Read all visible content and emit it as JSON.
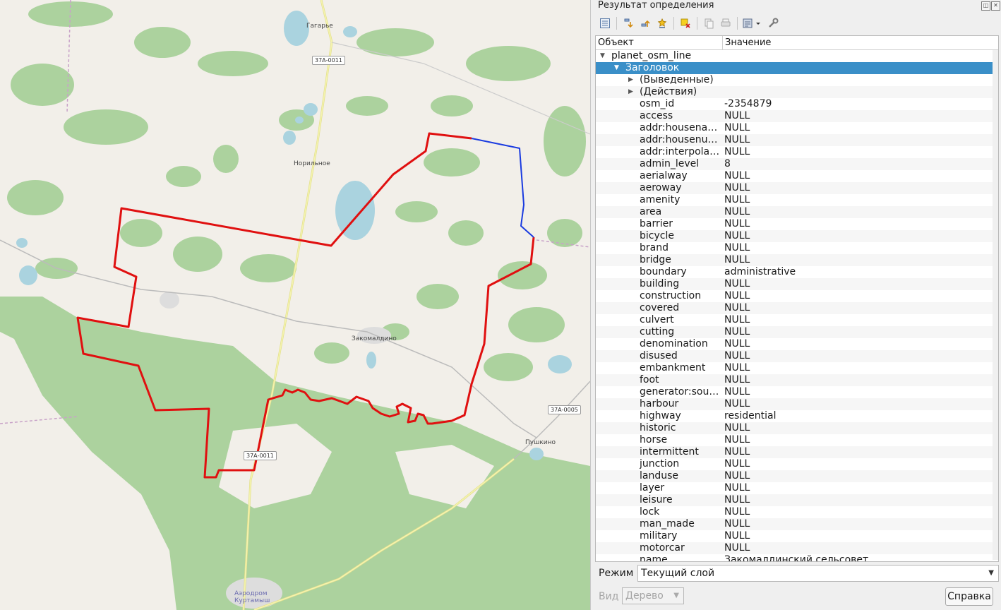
{
  "map": {
    "places": {
      "gagarye": "Гагарье",
      "norilnoe": "Норильное",
      "zakomaldino": "Закомалдино",
      "pushkino": "Пушкино",
      "airport": "Аэродром\nКуртамыш"
    },
    "road_shields": {
      "north": "37А-0011",
      "south": "37А-0011",
      "east": "37А-0005"
    },
    "colors": {
      "background": "#f2efe9",
      "forest": "#acd29e",
      "water": "#aad3df",
      "boundary_selected": "#e01010",
      "boundary_highlight": "#1a3be0",
      "road": "#f0ef9c"
    }
  },
  "panel": {
    "title": "Результат определения",
    "toolbar": {
      "icons": [
        "expand-all-icon",
        "collapse-all-icon",
        "expand-new-icon",
        "collapse-new-icon",
        "clear-selection-icon",
        "copy-attribute-icon",
        "print-icon",
        "identify-options-icon",
        "settings-icon"
      ]
    },
    "tree": {
      "col_object": "Объект",
      "col_value": "Значение",
      "layer": "planet_osm_line",
      "feature": "Заголовок",
      "derived": "(Выведенные)",
      "actions": "(Действия)",
      "attributes": [
        {
          "name": "osm_id",
          "value": "-2354879"
        },
        {
          "name": "access",
          "value": "NULL"
        },
        {
          "name": "addr:housena…",
          "value": "NULL"
        },
        {
          "name": "addr:housenu…",
          "value": "NULL"
        },
        {
          "name": "addr:interpola…",
          "value": "NULL"
        },
        {
          "name": "admin_level",
          "value": "8"
        },
        {
          "name": "aerialway",
          "value": "NULL"
        },
        {
          "name": "aeroway",
          "value": "NULL"
        },
        {
          "name": "amenity",
          "value": "NULL"
        },
        {
          "name": "area",
          "value": "NULL"
        },
        {
          "name": "barrier",
          "value": "NULL"
        },
        {
          "name": "bicycle",
          "value": "NULL"
        },
        {
          "name": "brand",
          "value": "NULL"
        },
        {
          "name": "bridge",
          "value": "NULL"
        },
        {
          "name": "boundary",
          "value": "administrative"
        },
        {
          "name": "building",
          "value": "NULL"
        },
        {
          "name": "construction",
          "value": "NULL"
        },
        {
          "name": "covered",
          "value": "NULL"
        },
        {
          "name": "culvert",
          "value": "NULL"
        },
        {
          "name": "cutting",
          "value": "NULL"
        },
        {
          "name": "denomination",
          "value": "NULL"
        },
        {
          "name": "disused",
          "value": "NULL"
        },
        {
          "name": "embankment",
          "value": "NULL"
        },
        {
          "name": "foot",
          "value": "NULL"
        },
        {
          "name": "generator:sou…",
          "value": "NULL"
        },
        {
          "name": "harbour",
          "value": "NULL"
        },
        {
          "name": "highway",
          "value": "residential"
        },
        {
          "name": "historic",
          "value": "NULL"
        },
        {
          "name": "horse",
          "value": "NULL"
        },
        {
          "name": "intermittent",
          "value": "NULL"
        },
        {
          "name": "junction",
          "value": "NULL"
        },
        {
          "name": "landuse",
          "value": "NULL"
        },
        {
          "name": "layer",
          "value": "NULL"
        },
        {
          "name": "leisure",
          "value": "NULL"
        },
        {
          "name": "lock",
          "value": "NULL"
        },
        {
          "name": "man_made",
          "value": "NULL"
        },
        {
          "name": "military",
          "value": "NULL"
        },
        {
          "name": "motorcar",
          "value": "NULL"
        },
        {
          "name": "name",
          "value": "Закомалдинский сельсовет"
        }
      ]
    },
    "mode_label": "Режим",
    "mode_value": "Текущий слой",
    "view_label": "Вид",
    "view_value": "Дерево",
    "help_label": "Справка"
  }
}
